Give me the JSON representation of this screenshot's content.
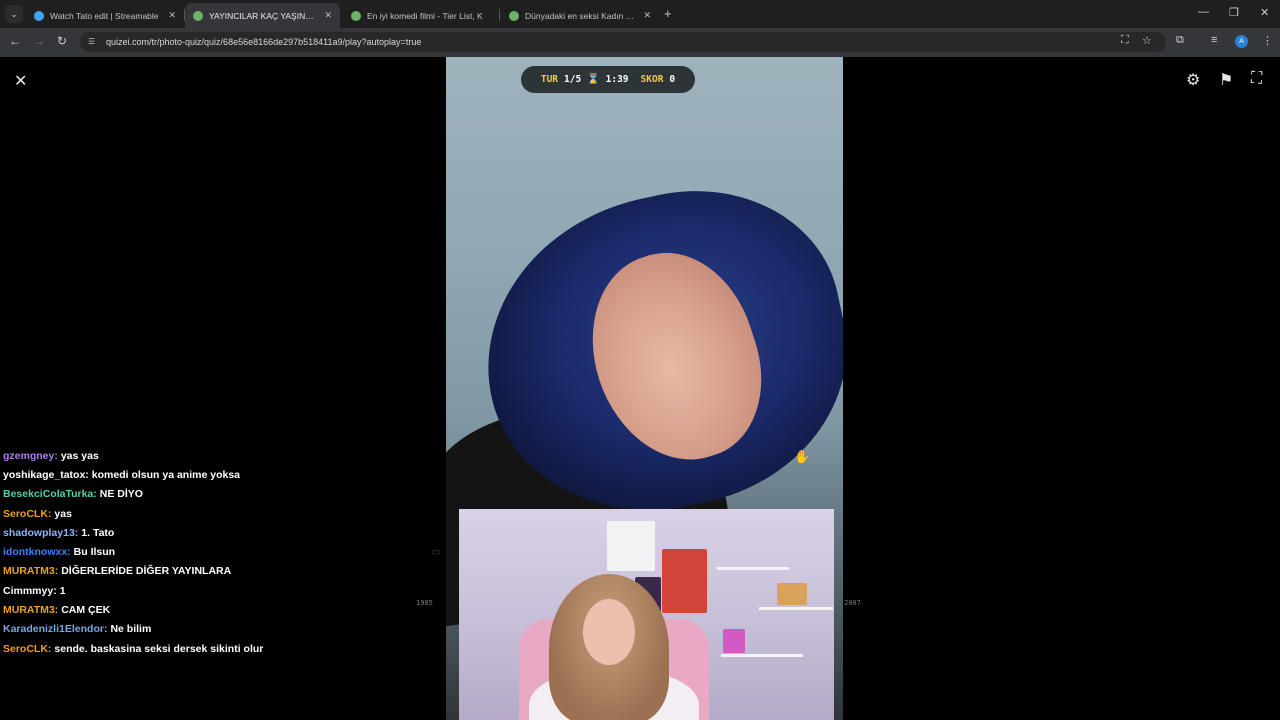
{
  "browser": {
    "tabs": [
      {
        "title": "Watch Tato edit | Streamable",
        "favicon_color": "#3ea6ff",
        "active": false
      },
      {
        "title": "YAYINCILAR KAÇ YAŞINDA ? - Q",
        "favicon_color": "#6db36a",
        "active": true
      },
      {
        "title": "En iyi komedi filmi - Tier List, K",
        "favicon_color": "#6db36a",
        "active": false
      },
      {
        "title": "Dünyadaki en seksi Kadın kim -",
        "favicon_color": "#6db36a",
        "active": false
      }
    ],
    "tab_close": "✕",
    "new_tab": "+",
    "url": "quizei.com/tr/photo-quiz/quiz/68e56e8166de297b518411a9/play?autoplay=true",
    "profile_initial": "A",
    "window_controls": {
      "minimize": "—",
      "restore": "❐",
      "close": "✕"
    },
    "nav": {
      "back": "←",
      "forward": "→",
      "reload": "↻"
    },
    "toolbar_icons": {
      "translate": "⛶",
      "star": "☆",
      "extensions": "⧉",
      "media": "≡",
      "menu": "⋮"
    }
  },
  "quiz": {
    "round_label": "TUR",
    "round_value": "1/5",
    "timer": "1:39",
    "score_label": "SKOR",
    "score_value": "0",
    "year_left": "1985",
    "year_right": "2007"
  },
  "page_icons": {
    "close": "✕",
    "settings": "⚙",
    "flag": "⚑",
    "fullscreen": "⛶"
  },
  "chat": [
    {
      "user": "gzemgney:",
      "color": "#b07cf0",
      "message": "yas yas"
    },
    {
      "user": "yoshikage_tatox:",
      "color": "#ffffff",
      "message": "komedi olsun ya anime yoksa"
    },
    {
      "user": "BesekciColaTurka:",
      "color": "#4fd1a8",
      "message": "NE DİYO"
    },
    {
      "user": "SeroCLK:",
      "color": "#f0a020",
      "message": "yas"
    },
    {
      "user": "shadowplay13:",
      "color": "#8ab4f8",
      "message": "1. Tato"
    },
    {
      "user": "idontknowxx:",
      "color": "#3b82f6",
      "message": "Bu Ilsun"
    },
    {
      "user": "MURATM3:",
      "color": "#f0a020",
      "message": "DİĞERLERİDE DİĞER YAYINLARA"
    },
    {
      "user": "Cimmmyy:",
      "color": "#ffffff",
      "message": "1"
    },
    {
      "user": "MURATM3:",
      "color": "#f0a020",
      "message": "CAM ÇEK"
    },
    {
      "user": "Karadenizli1Elendor:",
      "color": "#7aa7e0",
      "message": "Ne bilim"
    },
    {
      "user": "SeroCLK:",
      "color": "#f0a020",
      "message": "sende. baskasina seksi dersek sikinti olur"
    }
  ]
}
